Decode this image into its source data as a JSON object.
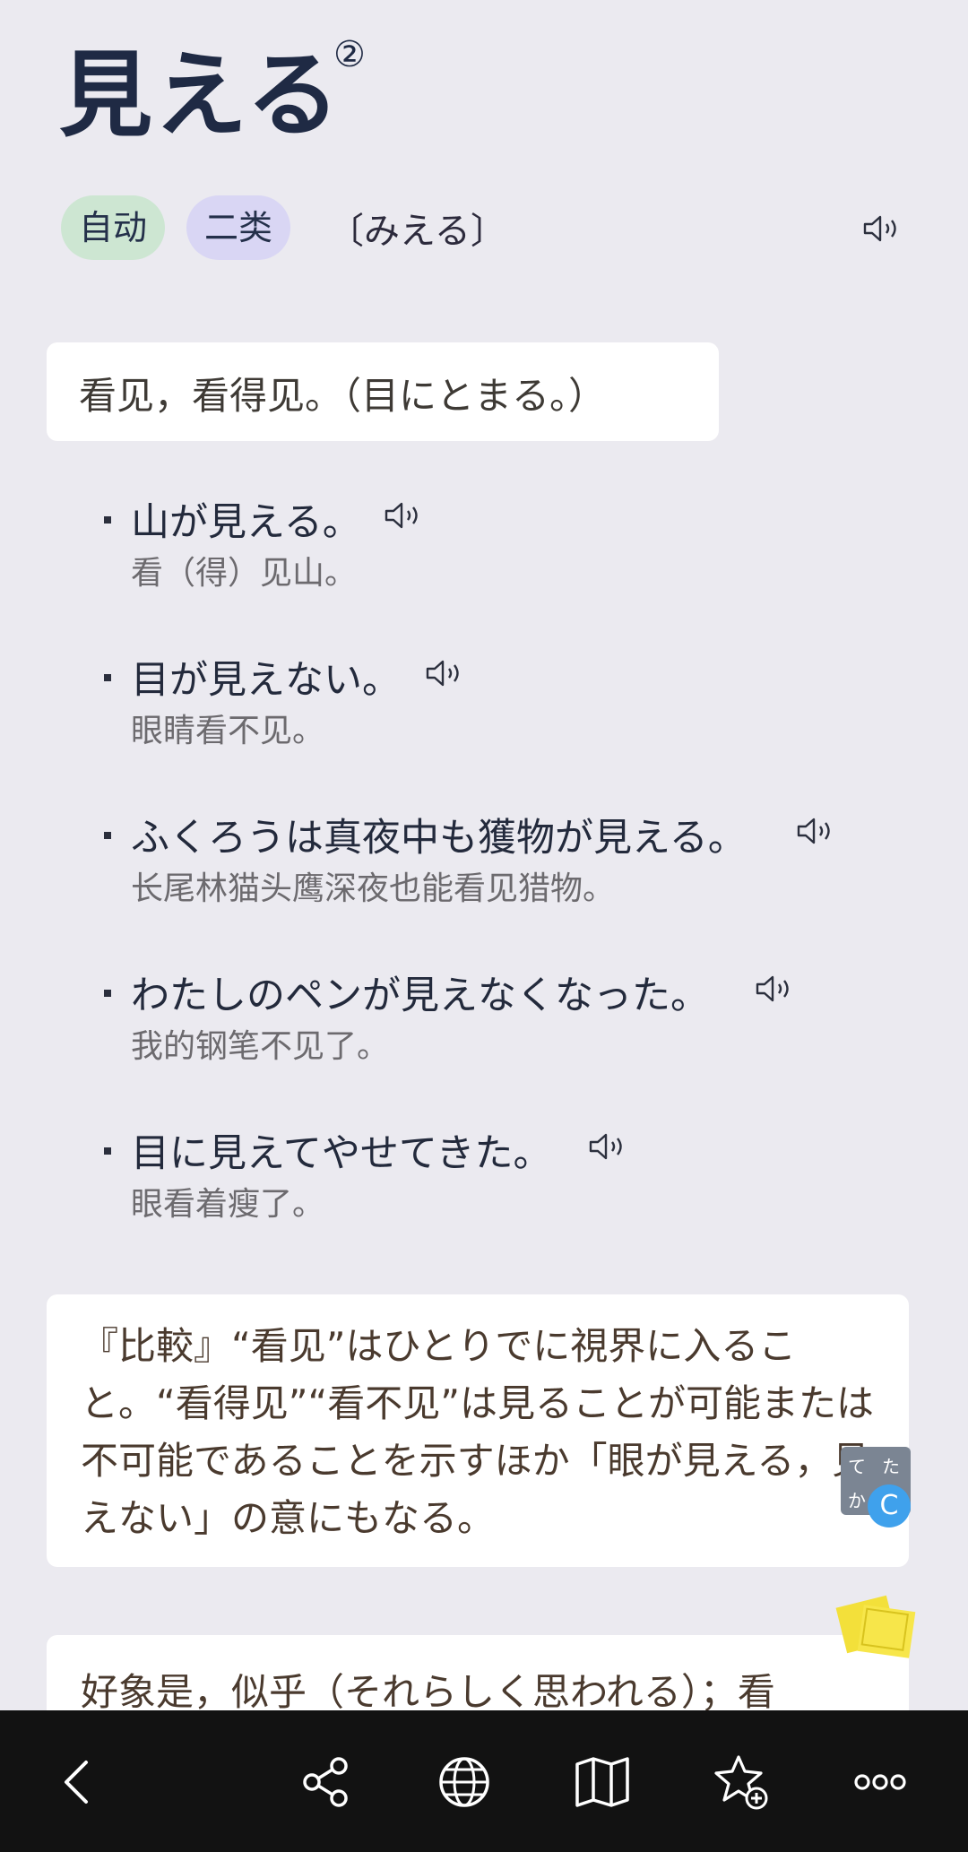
{
  "entry": {
    "headword": "見える",
    "homograph": "②",
    "tags": [
      "自动",
      "二类"
    ],
    "reading": "〔みえる〕",
    "icons": {
      "pronounce": "speaker-icon"
    }
  },
  "definition": {
    "text": "看见，看得见。（目にとまる。）"
  },
  "examples": [
    {
      "jp": "山が見える。",
      "cn": "看（得）见山。"
    },
    {
      "jp": "目が見えない。",
      "cn": "眼睛看不见。"
    },
    {
      "jp": "ふくろうは真夜中も獲物が見える。",
      "cn": "长尾林猫头鹰深夜也能看见猎物。"
    },
    {
      "jp": "わたしのペンが見えなくなった。",
      "cn": "我的钢笔不见了。"
    },
    {
      "jp": "目に見えてやせてきた。",
      "cn": "眼看着瘦了。"
    }
  ],
  "note": {
    "text": "『比較』“看见”はひとりでに視界に入ること。“看得见”“看不见”は見ることが可能または不可能であることを示すほか「眼が見える，見えない」の意にもなる。"
  },
  "second_definition": {
    "text": "好象是，似乎（それらしく思われる）；看"
  },
  "ime_widget": {
    "keys": [
      "て",
      "た",
      "か"
    ],
    "badge": "C"
  },
  "bottom_bar": {
    "icons": [
      "back-icon",
      "share-icon",
      "globe-icon",
      "map-icon",
      "favorite-add-icon",
      "more-icon"
    ]
  }
}
